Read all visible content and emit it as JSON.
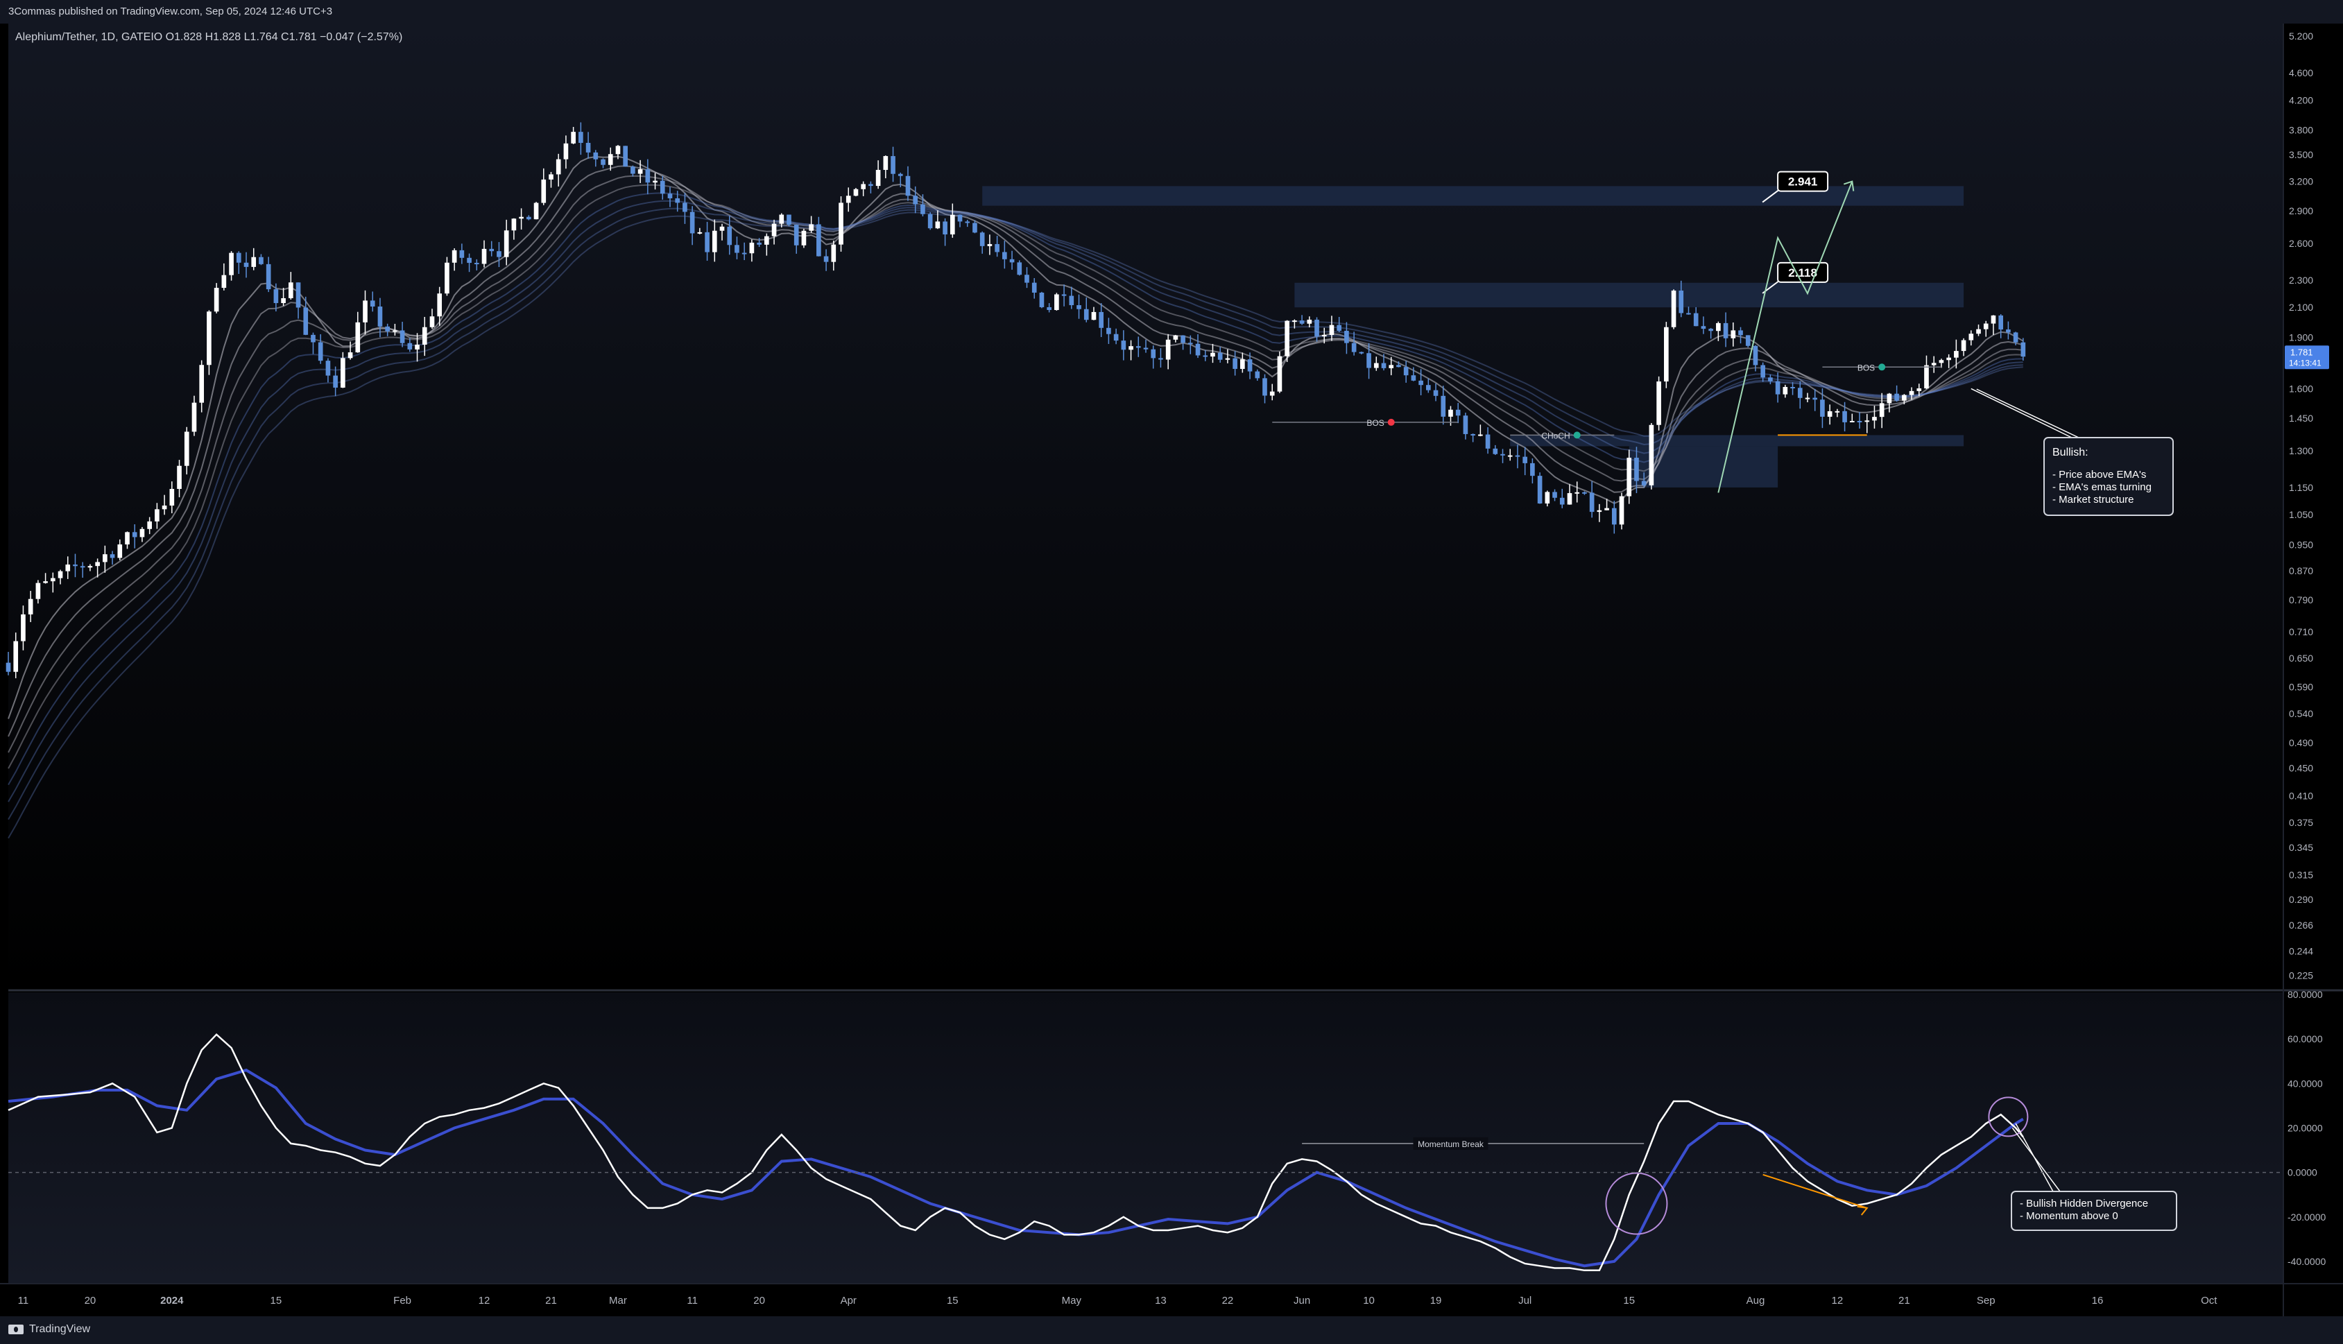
{
  "header": {
    "published": "3Commas published on TradingView.com, Sep 05, 2024 12:46 UTC+3"
  },
  "footer": {
    "brand": "TradingView"
  },
  "chart_data": {
    "type": "candlestick",
    "symbol_line": "Alephium/Tether, 1D, GATEIO  O1.828  H1.828  L1.764  C1.781  −0.047 (−2.57%)",
    "price_axis": [
      "5.200",
      "4.600",
      "4.200",
      "3.800",
      "3.500",
      "3.200",
      "2.900",
      "2.600",
      "2.300",
      "2.100",
      "1.900",
      "1.600",
      "1.450",
      "1.300",
      "1.150",
      "1.050",
      "0.950",
      "0.870",
      "0.790",
      "0.710",
      "0.650",
      "0.590",
      "0.540",
      "0.490",
      "0.450",
      "0.410",
      "0.375",
      "0.345",
      "0.315",
      "0.290",
      "0.266",
      "0.244",
      "0.225"
    ],
    "price_ylim": [
      0.215,
      5.3
    ],
    "scale": "log",
    "last_price": "1.781",
    "countdown": "14:13:41",
    "osc_axis": [
      "80.0000",
      "60.0000",
      "40.0000",
      "20.0000",
      "0.0000",
      "-20.0000",
      "-40.0000"
    ],
    "osc_ylim": [
      -50,
      80
    ],
    "time_labels": [
      {
        "label": "11",
        "day": -4
      },
      {
        "label": "20",
        "day": 5
      },
      {
        "label": "2024",
        "day": 16,
        "bold": true
      },
      {
        "label": "15",
        "day": 30
      },
      {
        "label": "Feb",
        "day": 47
      },
      {
        "label": "12",
        "day": 58
      },
      {
        "label": "21",
        "day": 67
      },
      {
        "label": "Mar",
        "day": 76
      },
      {
        "label": "11",
        "day": 86
      },
      {
        "label": "20",
        "day": 95
      },
      {
        "label": "Apr",
        "day": 107
      },
      {
        "label": "15",
        "day": 121
      },
      {
        "label": "May",
        "day": 137
      },
      {
        "label": "13",
        "day": 149
      },
      {
        "label": "22",
        "day": 158
      },
      {
        "label": "Jun",
        "day": 168
      },
      {
        "label": "10",
        "day": 177
      },
      {
        "label": "19",
        "day": 186
      },
      {
        "label": "Jul",
        "day": 198
      },
      {
        "label": "15",
        "day": 212
      },
      {
        "label": "Aug",
        "day": 229
      },
      {
        "label": "12",
        "day": 240
      },
      {
        "label": "21",
        "day": 249
      },
      {
        "label": "Sep",
        "day": 260
      },
      {
        "label": "16",
        "day": 275
      },
      {
        "label": "Oct",
        "day": 290
      }
    ],
    "day_range": [
      -6,
      300
    ],
    "price_keyframes": [
      [
        -6,
        0.64
      ],
      [
        -4,
        0.76
      ],
      [
        -2,
        0.82
      ],
      [
        0,
        0.84
      ],
      [
        3,
        0.88
      ],
      [
        6,
        0.9
      ],
      [
        9,
        0.95
      ],
      [
        12,
        1.0
      ],
      [
        14,
        1.08
      ],
      [
        16,
        1.12
      ],
      [
        18,
        1.35
      ],
      [
        20,
        1.75
      ],
      [
        22,
        2.3
      ],
      [
        24,
        2.5
      ],
      [
        26,
        2.35
      ],
      [
        28,
        2.5
      ],
      [
        30,
        2.1
      ],
      [
        32,
        2.3
      ],
      [
        34,
        1.9
      ],
      [
        36,
        1.75
      ],
      [
        38,
        1.65
      ],
      [
        40,
        1.85
      ],
      [
        42,
        2.1
      ],
      [
        44,
        2.0
      ],
      [
        46,
        1.9
      ],
      [
        48,
        1.8
      ],
      [
        50,
        1.95
      ],
      [
        52,
        2.2
      ],
      [
        54,
        2.55
      ],
      [
        56,
        2.4
      ],
      [
        58,
        2.6
      ],
      [
        60,
        2.55
      ],
      [
        62,
        2.75
      ],
      [
        64,
        2.9
      ],
      [
        66,
        3.2
      ],
      [
        68,
        3.5
      ],
      [
        70,
        3.8
      ],
      [
        72,
        3.6
      ],
      [
        74,
        3.45
      ],
      [
        76,
        3.5
      ],
      [
        78,
        3.3
      ],
      [
        80,
        3.2
      ],
      [
        82,
        3.1
      ],
      [
        84,
        2.95
      ],
      [
        86,
        2.7
      ],
      [
        88,
        2.55
      ],
      [
        90,
        2.8
      ],
      [
        92,
        2.5
      ],
      [
        94,
        2.55
      ],
      [
        96,
        2.65
      ],
      [
        98,
        2.8
      ],
      [
        100,
        2.6
      ],
      [
        102,
        2.7
      ],
      [
        104,
        2.4
      ],
      [
        106,
        2.9
      ],
      [
        108,
        3.1
      ],
      [
        110,
        3.2
      ],
      [
        112,
        3.4
      ],
      [
        114,
        3.2
      ],
      [
        116,
        2.9
      ],
      [
        118,
        2.7
      ],
      [
        120,
        2.75
      ],
      [
        122,
        2.85
      ],
      [
        124,
        2.7
      ],
      [
        126,
        2.6
      ],
      [
        128,
        2.45
      ],
      [
        130,
        2.3
      ],
      [
        132,
        2.2
      ],
      [
        134,
        2.1
      ],
      [
        136,
        2.25
      ],
      [
        138,
        2.1
      ],
      [
        140,
        2.05
      ],
      [
        142,
        1.95
      ],
      [
        144,
        1.85
      ],
      [
        146,
        1.8
      ],
      [
        148,
        1.75
      ],
      [
        150,
        1.85
      ],
      [
        152,
        1.9
      ],
      [
        154,
        1.75
      ],
      [
        156,
        1.8
      ],
      [
        158,
        1.75
      ],
      [
        160,
        1.72
      ],
      [
        162,
        1.65
      ],
      [
        164,
        1.55
      ],
      [
        166,
        2.05
      ],
      [
        168,
        2.0
      ],
      [
        170,
        1.95
      ],
      [
        172,
        1.95
      ],
      [
        174,
        1.85
      ],
      [
        176,
        1.75
      ],
      [
        178,
        1.72
      ],
      [
        180,
        1.7
      ],
      [
        182,
        1.65
      ],
      [
        184,
        1.6
      ],
      [
        186,
        1.55
      ],
      [
        188,
        1.45
      ],
      [
        190,
        1.4
      ],
      [
        192,
        1.35
      ],
      [
        194,
        1.3
      ],
      [
        196,
        1.28
      ],
      [
        198,
        1.25
      ],
      [
        200,
        1.12
      ],
      [
        202,
        1.1
      ],
      [
        204,
        1.12
      ],
      [
        206,
        1.1
      ],
      [
        208,
        1.08
      ],
      [
        210,
        1.04
      ],
      [
        212,
        1.25
      ],
      [
        214,
        1.15
      ],
      [
        216,
        1.62
      ],
      [
        218,
        2.2
      ],
      [
        220,
        2.0
      ],
      [
        222,
        1.95
      ],
      [
        224,
        2.0
      ],
      [
        226,
        1.9
      ],
      [
        228,
        1.85
      ],
      [
        230,
        1.7
      ],
      [
        232,
        1.55
      ],
      [
        234,
        1.6
      ],
      [
        236,
        1.52
      ],
      [
        238,
        1.48
      ],
      [
        240,
        1.45
      ],
      [
        242,
        1.42
      ],
      [
        244,
        1.48
      ],
      [
        246,
        1.52
      ],
      [
        248,
        1.55
      ],
      [
        250,
        1.6
      ],
      [
        252,
        1.7
      ],
      [
        254,
        1.8
      ],
      [
        256,
        1.85
      ],
      [
        258,
        1.9
      ],
      [
        260,
        2.05
      ],
      [
        262,
        2.0
      ],
      [
        264,
        1.82
      ],
      [
        265,
        1.78
      ]
    ],
    "ema_ribbon_count": 8,
    "osc_white": [
      [
        -6,
        28
      ],
      [
        -2,
        34
      ],
      [
        2,
        35
      ],
      [
        5,
        36
      ],
      [
        8,
        40
      ],
      [
        11,
        34
      ],
      [
        14,
        18
      ],
      [
        16,
        20
      ],
      [
        18,
        40
      ],
      [
        20,
        55
      ],
      [
        22,
        62
      ],
      [
        24,
        56
      ],
      [
        26,
        42
      ],
      [
        28,
        30
      ],
      [
        30,
        20
      ],
      [
        32,
        13
      ],
      [
        34,
        12
      ],
      [
        36,
        10
      ],
      [
        38,
        9
      ],
      [
        40,
        7
      ],
      [
        42,
        4
      ],
      [
        44,
        3
      ],
      [
        46,
        8
      ],
      [
        48,
        16
      ],
      [
        50,
        22
      ],
      [
        52,
        25
      ],
      [
        54,
        26
      ],
      [
        56,
        28
      ],
      [
        58,
        29
      ],
      [
        60,
        31
      ],
      [
        62,
        34
      ],
      [
        64,
        37
      ],
      [
        66,
        40
      ],
      [
        68,
        38
      ],
      [
        70,
        30
      ],
      [
        72,
        20
      ],
      [
        74,
        10
      ],
      [
        76,
        -2
      ],
      [
        78,
        -10
      ],
      [
        80,
        -16
      ],
      [
        82,
        -16
      ],
      [
        84,
        -14
      ],
      [
        86,
        -10
      ],
      [
        88,
        -8
      ],
      [
        90,
        -9
      ],
      [
        92,
        -5
      ],
      [
        94,
        0
      ],
      [
        96,
        10
      ],
      [
        98,
        17
      ],
      [
        100,
        10
      ],
      [
        102,
        2
      ],
      [
        104,
        -3
      ],
      [
        106,
        -6
      ],
      [
        108,
        -9
      ],
      [
        110,
        -12
      ],
      [
        112,
        -18
      ],
      [
        114,
        -24
      ],
      [
        116,
        -26
      ],
      [
        118,
        -20
      ],
      [
        120,
        -16
      ],
      [
        122,
        -18
      ],
      [
        124,
        -24
      ],
      [
        126,
        -28
      ],
      [
        128,
        -30
      ],
      [
        130,
        -27
      ],
      [
        132,
        -22
      ],
      [
        134,
        -24
      ],
      [
        136,
        -28
      ],
      [
        138,
        -28
      ],
      [
        140,
        -27
      ],
      [
        142,
        -24
      ],
      [
        144,
        -20
      ],
      [
        146,
        -24
      ],
      [
        148,
        -26
      ],
      [
        150,
        -26
      ],
      [
        152,
        -25
      ],
      [
        154,
        -24
      ],
      [
        156,
        -26
      ],
      [
        158,
        -27
      ],
      [
        160,
        -25
      ],
      [
        162,
        -20
      ],
      [
        164,
        -5
      ],
      [
        166,
        4
      ],
      [
        168,
        6
      ],
      [
        170,
        5
      ],
      [
        172,
        1
      ],
      [
        174,
        -4
      ],
      [
        176,
        -10
      ],
      [
        178,
        -14
      ],
      [
        180,
        -17
      ],
      [
        182,
        -20
      ],
      [
        184,
        -23
      ],
      [
        186,
        -24
      ],
      [
        188,
        -27
      ],
      [
        190,
        -29
      ],
      [
        192,
        -31
      ],
      [
        194,
        -34
      ],
      [
        196,
        -38
      ],
      [
        198,
        -41
      ],
      [
        200,
        -42
      ],
      [
        202,
        -43
      ],
      [
        204,
        -43
      ],
      [
        206,
        -44
      ],
      [
        208,
        -44
      ],
      [
        210,
        -30
      ],
      [
        212,
        -10
      ],
      [
        214,
        5
      ],
      [
        216,
        22
      ],
      [
        218,
        32
      ],
      [
        220,
        32
      ],
      [
        222,
        29
      ],
      [
        224,
        26
      ],
      [
        226,
        24
      ],
      [
        228,
        22
      ],
      [
        230,
        18
      ],
      [
        232,
        10
      ],
      [
        234,
        2
      ],
      [
        236,
        -4
      ],
      [
        238,
        -8
      ],
      [
        240,
        -12
      ],
      [
        242,
        -15
      ],
      [
        244,
        -14
      ],
      [
        246,
        -12
      ],
      [
        248,
        -10
      ],
      [
        250,
        -5
      ],
      [
        252,
        2
      ],
      [
        254,
        8
      ],
      [
        256,
        12
      ],
      [
        258,
        16
      ],
      [
        260,
        22
      ],
      [
        262,
        26
      ],
      [
        264,
        20
      ],
      [
        265,
        16
      ]
    ],
    "osc_blue": [
      [
        -6,
        32
      ],
      [
        0,
        34
      ],
      [
        6,
        37
      ],
      [
        10,
        37
      ],
      [
        14,
        30
      ],
      [
        18,
        28
      ],
      [
        22,
        42
      ],
      [
        26,
        46
      ],
      [
        30,
        38
      ],
      [
        34,
        22
      ],
      [
        38,
        15
      ],
      [
        42,
        10
      ],
      [
        46,
        8
      ],
      [
        50,
        14
      ],
      [
        54,
        20
      ],
      [
        58,
        24
      ],
      [
        62,
        28
      ],
      [
        66,
        33
      ],
      [
        70,
        33
      ],
      [
        74,
        22
      ],
      [
        78,
        8
      ],
      [
        82,
        -5
      ],
      [
        86,
        -10
      ],
      [
        90,
        -12
      ],
      [
        94,
        -8
      ],
      [
        98,
        5
      ],
      [
        102,
        6
      ],
      [
        106,
        2
      ],
      [
        110,
        -2
      ],
      [
        114,
        -8
      ],
      [
        118,
        -14
      ],
      [
        122,
        -18
      ],
      [
        126,
        -22
      ],
      [
        130,
        -26
      ],
      [
        134,
        -27
      ],
      [
        138,
        -28
      ],
      [
        142,
        -27
      ],
      [
        146,
        -24
      ],
      [
        150,
        -21
      ],
      [
        154,
        -22
      ],
      [
        158,
        -23
      ],
      [
        162,
        -20
      ],
      [
        166,
        -8
      ],
      [
        170,
        0
      ],
      [
        174,
        -4
      ],
      [
        178,
        -10
      ],
      [
        182,
        -16
      ],
      [
        186,
        -21
      ],
      [
        190,
        -26
      ],
      [
        194,
        -31
      ],
      [
        198,
        -35
      ],
      [
        202,
        -39
      ],
      [
        206,
        -42
      ],
      [
        210,
        -40
      ],
      [
        213,
        -30
      ],
      [
        216,
        -10
      ],
      [
        220,
        12
      ],
      [
        224,
        22
      ],
      [
        228,
        22
      ],
      [
        232,
        14
      ],
      [
        236,
        4
      ],
      [
        240,
        -4
      ],
      [
        244,
        -8
      ],
      [
        248,
        -10
      ],
      [
        252,
        -6
      ],
      [
        256,
        2
      ],
      [
        260,
        12
      ],
      [
        264,
        22
      ],
      [
        265,
        24
      ]
    ],
    "zones": [
      {
        "y1": 3.15,
        "y2": 2.95,
        "d1": 125,
        "d2": 257
      },
      {
        "y1": 2.28,
        "y2": 2.1,
        "d1": 167,
        "d2": 257
      },
      {
        "y1": 1.37,
        "y2": 1.32,
        "d1": 196,
        "d2": 257
      },
      {
        "y1": 1.32,
        "y2": 1.15,
        "d1": 212,
        "d2": 232
      }
    ],
    "targets": [
      {
        "label": "2.941",
        "price": 3.2,
        "day": 232
      },
      {
        "label": "2.118",
        "price": 2.36,
        "day": 232
      }
    ],
    "markers": [
      {
        "label": "BOS",
        "price": 1.43,
        "day": 180,
        "color": "#f23645",
        "line_from": 164,
        "line_to": 189
      },
      {
        "label": "CHoCH",
        "price": 1.37,
        "day": 205,
        "color": "#22ab94",
        "line_from": 196,
        "line_to": 210
      },
      {
        "label": "BOS",
        "price": 1.72,
        "day": 246,
        "color": "#22ab94",
        "line_from": 238,
        "line_to": 254
      }
    ],
    "osc_label": "Momentum Break",
    "annotation_main": {
      "title": "Bullish:",
      "lines": [
        "- Price above EMA's",
        "- EMA's emas turning",
        "- Market structure"
      ]
    },
    "annotation_osc": {
      "lines": [
        "- Bullish Hidden Divergence",
        "- Momentum above 0"
      ]
    },
    "colors": {
      "bull": "#ffffff",
      "bear": "#5b8fd9",
      "osc_fast": "#ffffff",
      "osc_slow": "#3b4fd0",
      "zone": "#1c2a45",
      "orange": "#ff9800",
      "proj": "#9fd8b4",
      "circle": "#b58bd9",
      "last_price_bg": "#4a82e8"
    }
  }
}
